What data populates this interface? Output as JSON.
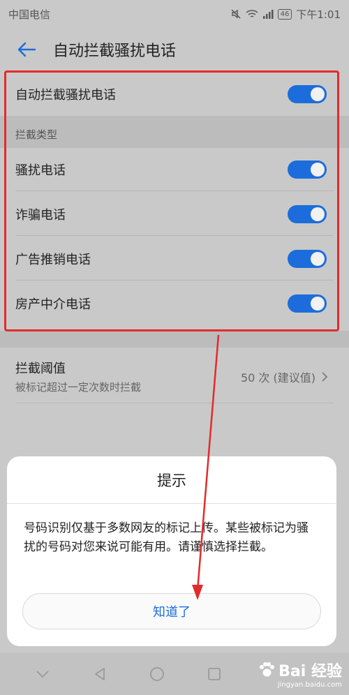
{
  "status_bar": {
    "carrier": "中国电信",
    "battery": "46",
    "time": "下午1:01"
  },
  "header": {
    "title": "自动拦截骚扰电话"
  },
  "main_toggle": {
    "label": "自动拦截骚扰电话",
    "on": true
  },
  "section": {
    "title": "拦截类型"
  },
  "types": [
    {
      "label": "骚扰电话",
      "on": true
    },
    {
      "label": "诈骗电话",
      "on": true
    },
    {
      "label": "广告推销电话",
      "on": true
    },
    {
      "label": "房产中介电话",
      "on": true
    }
  ],
  "threshold": {
    "title": "拦截阈值",
    "subtitle": "被标记超过一定次数时拦截",
    "value": "50 次 (建议值)"
  },
  "dialog": {
    "title": "提示",
    "body": "号码识别仅基于多数网友的标记上传。某些被标记为骚扰的号码对您来说可能有用。请谨慎选择拦截。",
    "ok_label": "知道了"
  },
  "watermark": {
    "brand": "Bai 经验",
    "site": "jingyan.baidu.com"
  },
  "colors": {
    "accent": "#1c6ddb",
    "highlight": "#e32b2b"
  }
}
